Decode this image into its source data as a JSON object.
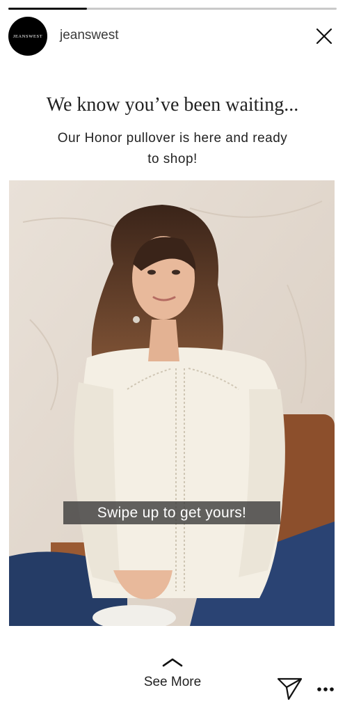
{
  "story": {
    "progress_fraction": 0.24
  },
  "header": {
    "avatar_text": "JEANSWEST",
    "username": "jeanswest",
    "close_icon": "close-icon"
  },
  "content": {
    "headline": "We know you’ve been waiting...",
    "subline": "Our Honor pullover is here and ready to shop!",
    "caption": "Swipe up to get yours!"
  },
  "footer": {
    "see_more_label": "See More",
    "chevron_icon": "chevron-up-icon",
    "send_icon": "send-icon",
    "more_icon": "more-icon"
  },
  "colors": {
    "background": "#ffffff",
    "progress_track": "#c9c9c9",
    "progress_fill": "#111111",
    "caption_bg": "#373737",
    "avatar_bg": "#000000"
  }
}
